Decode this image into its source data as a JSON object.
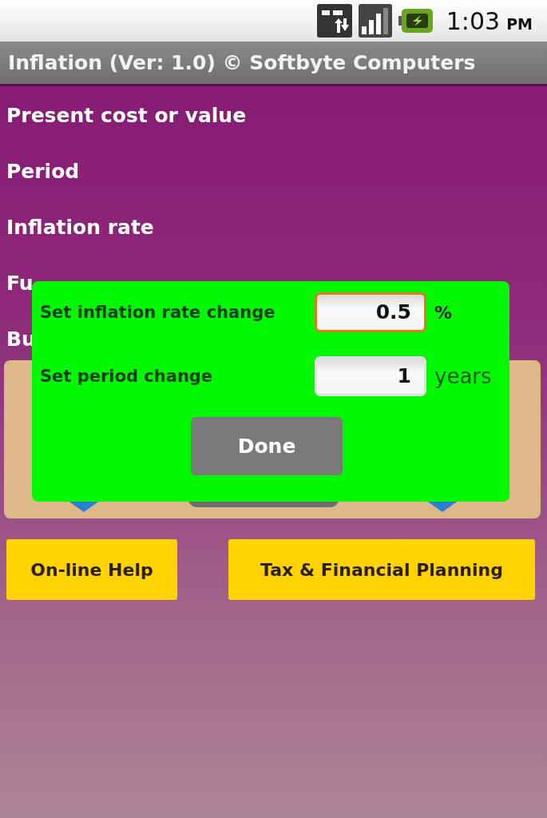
{
  "status_bar": {
    "time": "1:03",
    "period": "PM"
  },
  "title_bar": {
    "title": "Inflation (Ver: 1.0) © Softbyte Computers"
  },
  "fields": [
    {
      "label": "Present cost or value"
    },
    {
      "label": "Period"
    },
    {
      "label": "Inflation rate"
    },
    {
      "label": "Fu"
    },
    {
      "label": "Bu"
    }
  ],
  "dialog": {
    "rows": [
      {
        "label": "Set inflation rate change",
        "value": "0.5",
        "unit": "%",
        "focused": true
      },
      {
        "label": "Set period change",
        "value": "1",
        "unit": "years",
        "focused": false
      }
    ],
    "button": "Done"
  },
  "buttons": [
    "On-line Help",
    "Tax & Financial Planning"
  ]
}
